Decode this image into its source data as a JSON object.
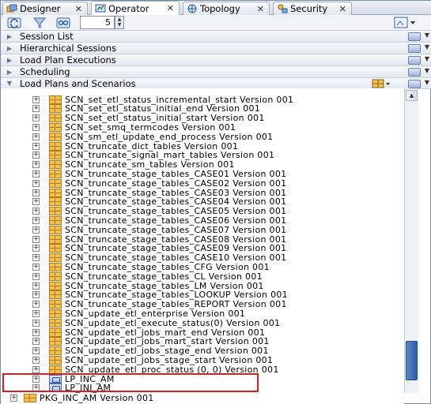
{
  "tabs": [
    {
      "label": "Designer",
      "icon": "designer-icon",
      "active": false
    },
    {
      "label": "Operator",
      "icon": "operator-icon",
      "active": true
    },
    {
      "label": "Topology",
      "icon": "topology-icon",
      "active": false
    },
    {
      "label": "Security",
      "icon": "security-icon",
      "active": false
    }
  ],
  "toolbar": {
    "refresh_icon": "refresh-icon",
    "filter_icon": "filter-icon",
    "connect_icon": "connect-icon",
    "spinner_value": "5",
    "view_menu_icon": "view-menu-icon"
  },
  "accordion": {
    "session_list": "Session List",
    "hierarchical_sessions": "Hierarchical Sessions",
    "load_plan_executions": "Load Plan Executions",
    "scheduling": "Scheduling",
    "load_plans_and_scenarios": "Load Plans and Scenarios"
  },
  "tree": {
    "rows": [
      {
        "label": "SCN_set_etl_status_incremental_start Version 001",
        "type": "scenario"
      },
      {
        "label": "SCN_set_etl_status_initial_end Version 001",
        "type": "scenario"
      },
      {
        "label": "SCN_set_etl_status_initial_start Version 001",
        "type": "scenario"
      },
      {
        "label": "SCN_set_smq_termcodes Version 001",
        "type": "scenario"
      },
      {
        "label": "SCN_sm_etl_update_end_process Version 001",
        "type": "scenario"
      },
      {
        "label": "SCN_truncate_dict_tables Version 001",
        "type": "scenario"
      },
      {
        "label": "SCN_truncate_signal_mart_tables Version 001",
        "type": "scenario"
      },
      {
        "label": "SCN_truncate_sm_tables Version 001",
        "type": "scenario"
      },
      {
        "label": "SCN_truncate_stage_tables_CASE01 Version 001",
        "type": "scenario"
      },
      {
        "label": "SCN_truncate_stage_tables_CASE02 Version 001",
        "type": "scenario"
      },
      {
        "label": "SCN_truncate_stage_tables_CASE03 Version 001",
        "type": "scenario"
      },
      {
        "label": "SCN_truncate_stage_tables_CASE04 Version 001",
        "type": "scenario"
      },
      {
        "label": "SCN_truncate_stage_tables_CASE05 Version 001",
        "type": "scenario"
      },
      {
        "label": "SCN_truncate_stage_tables_CASE06 Version 001",
        "type": "scenario"
      },
      {
        "label": "SCN_truncate_stage_tables_CASE07 Version 001",
        "type": "scenario"
      },
      {
        "label": "SCN_truncate_stage_tables_CASE08 Version 001",
        "type": "scenario"
      },
      {
        "label": "SCN_truncate_stage_tables_CASE09 Version 001",
        "type": "scenario"
      },
      {
        "label": "SCN_truncate_stage_tables_CASE10 Version 001",
        "type": "scenario"
      },
      {
        "label": "SCN_truncate_stage_tables_CFG Version 001",
        "type": "scenario"
      },
      {
        "label": "SCN_truncate_stage_tables_CL Version 001",
        "type": "scenario"
      },
      {
        "label": "SCN_truncate_stage_tables_LM Version 001",
        "type": "scenario"
      },
      {
        "label": "SCN_truncate_stage_tables_LOOKUP Version 001",
        "type": "scenario"
      },
      {
        "label": "SCN_truncate_stage_tables_REPORT Version 001",
        "type": "scenario"
      },
      {
        "label": "SCN_update_etl_enterprise Version 001",
        "type": "scenario"
      },
      {
        "label": "SCN_update_etl_execute_status(0) Version 001",
        "type": "scenario"
      },
      {
        "label": "SCN_update_etl_jobs_mart_end Version 001",
        "type": "scenario"
      },
      {
        "label": "SCN_update_etl_jobs_mart_start Version 001",
        "type": "scenario"
      },
      {
        "label": "SCN_update_etl_jobs_stage_end Version 001",
        "type": "scenario"
      },
      {
        "label": "SCN_update_etl_jobs_stage_start Version 001",
        "type": "scenario"
      },
      {
        "label": "SCN_update_etl_proc_status (0, 0) Version 001",
        "type": "scenario"
      },
      {
        "label": "LP_INC_AM",
        "type": "loadplan"
      },
      {
        "label": "LP_INI_AM",
        "type": "loadplan"
      }
    ],
    "bottom_row": {
      "label": "PKG_INC_AM Version 001",
      "type": "scenario"
    }
  },
  "colors": {
    "highlight": "#e01b24",
    "scroll_thumb": "#2f5ea8"
  }
}
